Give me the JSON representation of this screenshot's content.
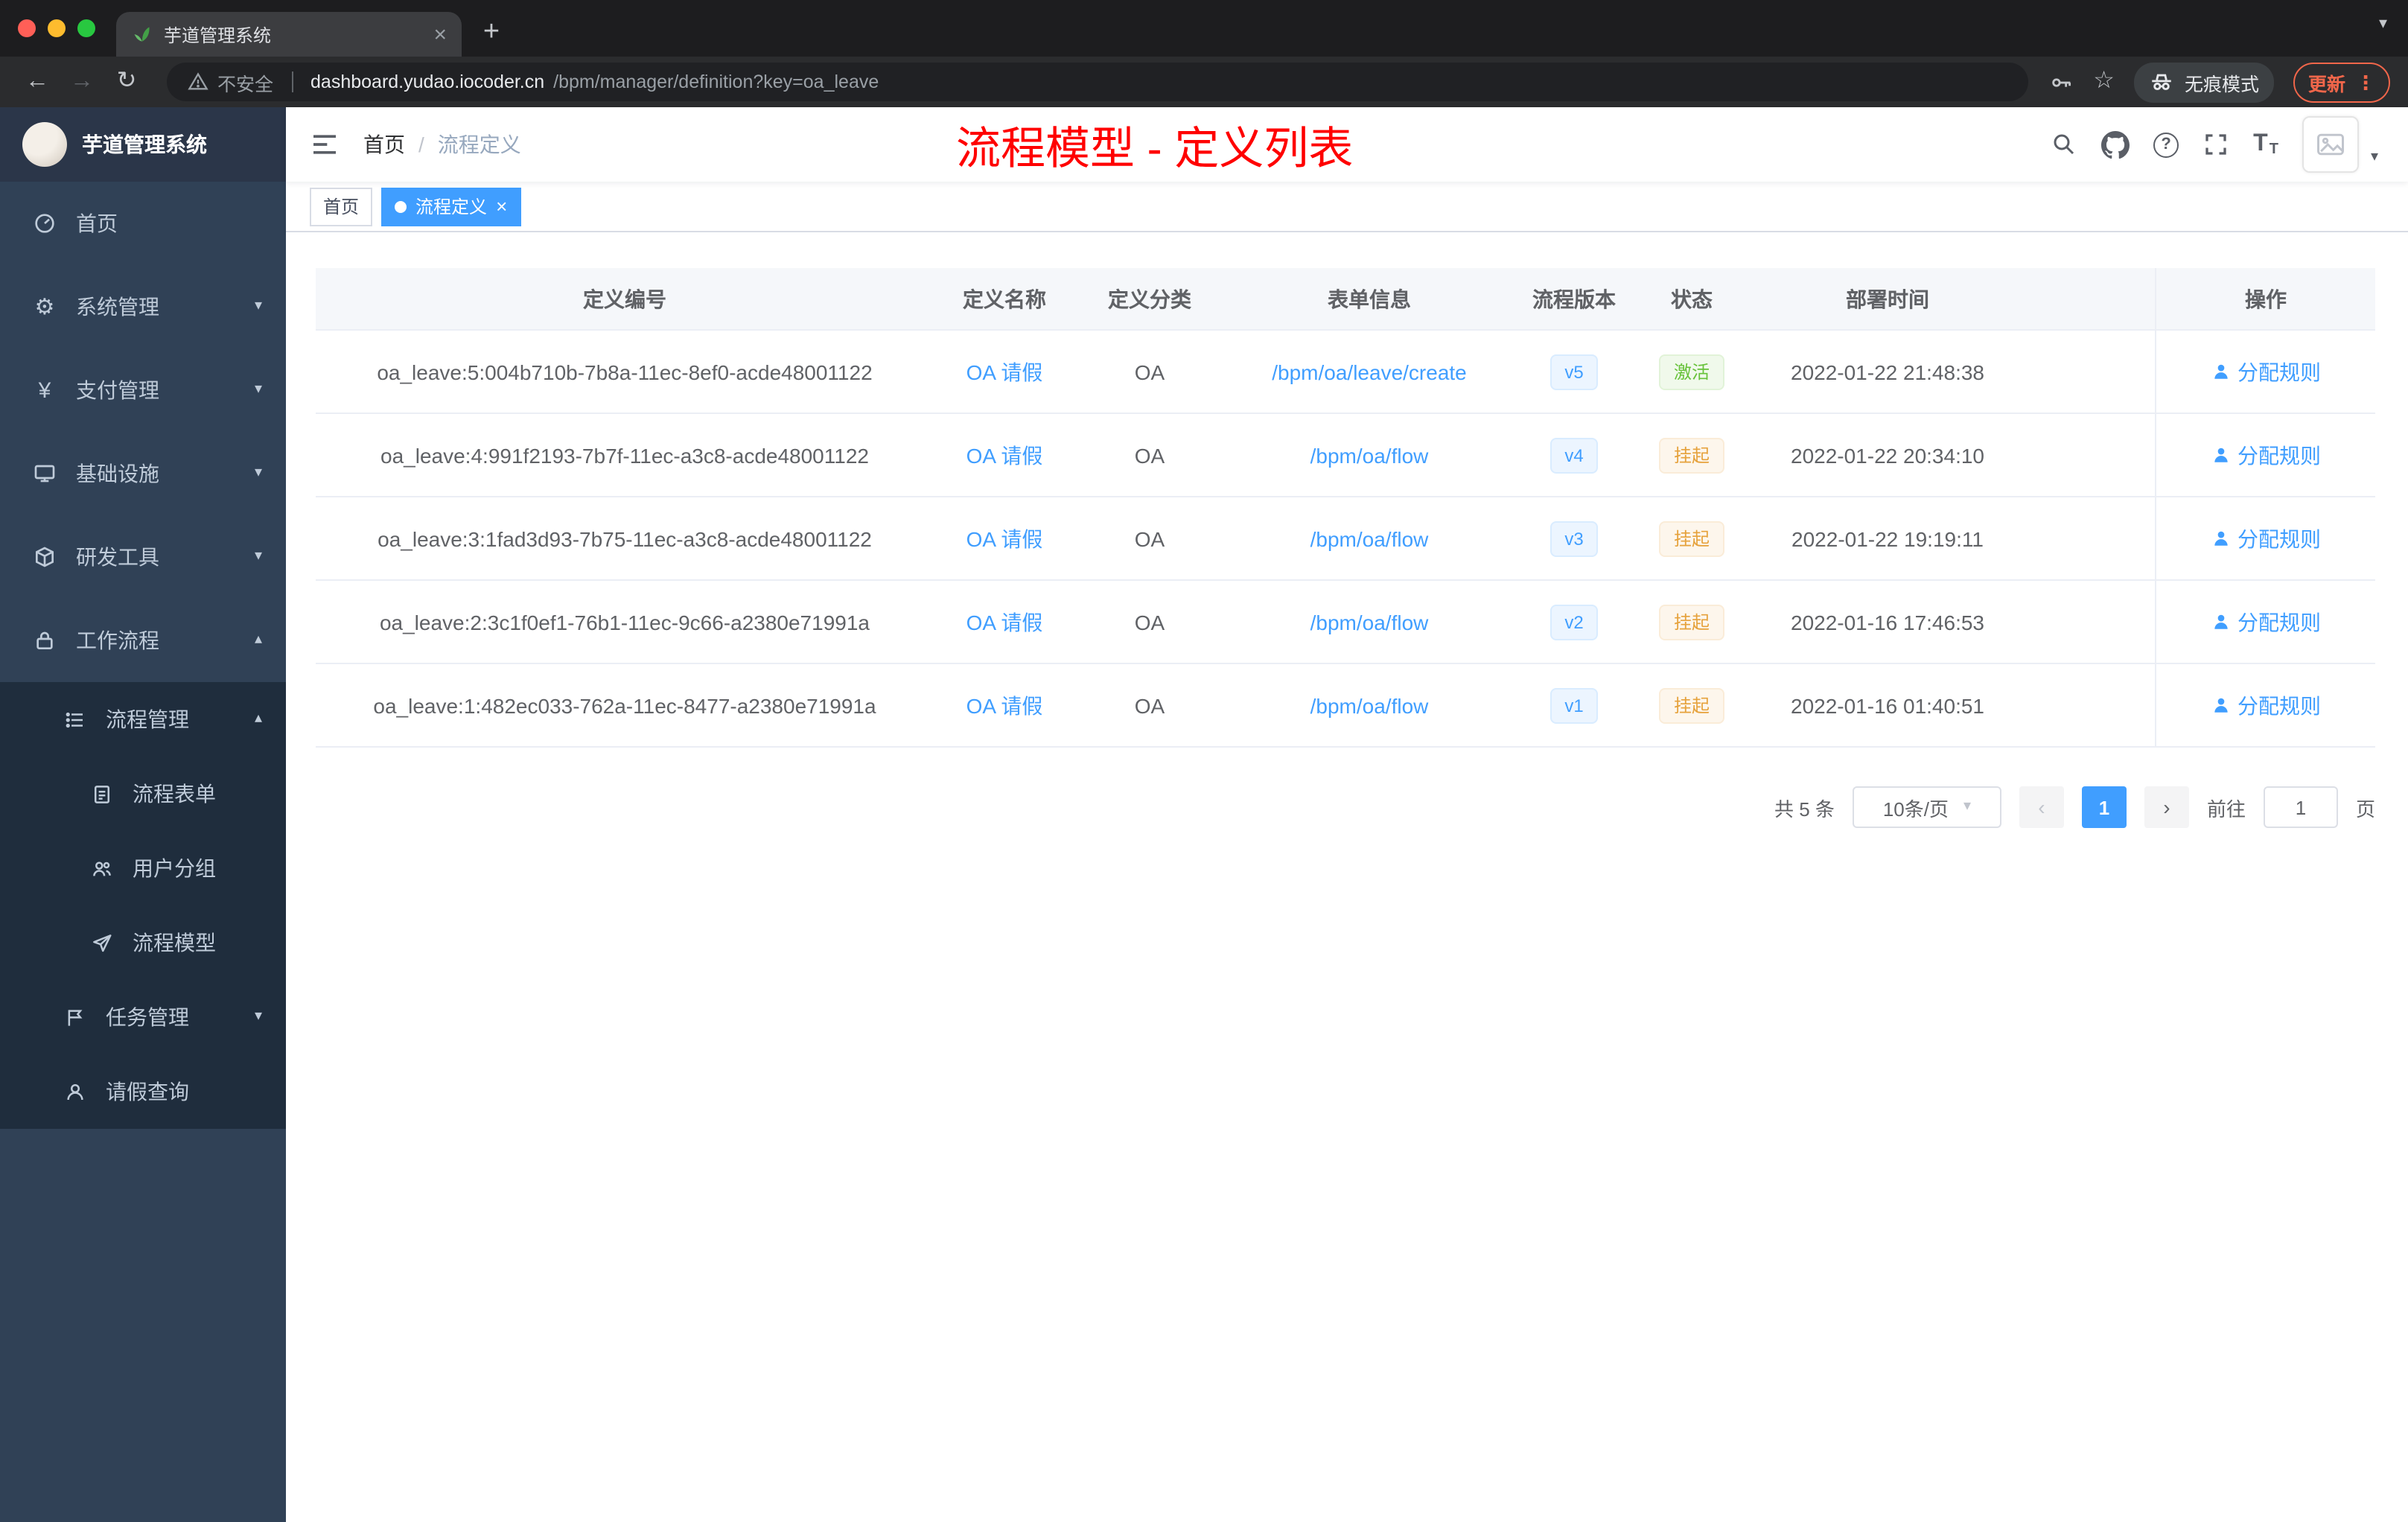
{
  "browser": {
    "tab_title": "芋道管理系统",
    "address": {
      "not_secure": "不安全",
      "domain": "dashboard.yudao.iocoder.cn",
      "path": "/bpm/manager/definition?key=oa_leave"
    },
    "incognito_label": "无痕模式",
    "update_label": "更新"
  },
  "sidebar": {
    "app_title": "芋道管理系统",
    "menu": [
      {
        "label": "首页"
      },
      {
        "label": "系统管理"
      },
      {
        "label": "支付管理"
      },
      {
        "label": "基础设施"
      },
      {
        "label": "研发工具"
      },
      {
        "label": "工作流程"
      }
    ],
    "submenu": [
      {
        "label": "流程管理"
      },
      {
        "label": "流程表单"
      },
      {
        "label": "用户分组"
      },
      {
        "label": "流程模型"
      },
      {
        "label": "任务管理"
      },
      {
        "label": "请假查询"
      }
    ]
  },
  "header": {
    "breadcrumb": [
      "首页",
      "流程定义"
    ],
    "annotation": "流程模型 - 定义列表"
  },
  "tags": [
    {
      "label": "首页"
    },
    {
      "label": "流程定义"
    }
  ],
  "table": {
    "columns": [
      "定义编号",
      "定义名称",
      "定义分类",
      "表单信息",
      "流程版本",
      "状态",
      "部署时间",
      "操作"
    ],
    "rows": [
      {
        "id": "oa_leave:5:004b710b-7b8a-11ec-8ef0-acde48001122",
        "name": "OA 请假",
        "category": "OA",
        "form": "/bpm/oa/leave/create",
        "version": "v5",
        "status": "激活",
        "deployed": "2022-01-22 21:48:38",
        "action": "分配规则"
      },
      {
        "id": "oa_leave:4:991f2193-7b7f-11ec-a3c8-acde48001122",
        "name": "OA 请假",
        "category": "OA",
        "form": "/bpm/oa/flow",
        "version": "v4",
        "status": "挂起",
        "deployed": "2022-01-22 20:34:10",
        "action": "分配规则"
      },
      {
        "id": "oa_leave:3:1fad3d93-7b75-11ec-a3c8-acde48001122",
        "name": "OA 请假",
        "category": "OA",
        "form": "/bpm/oa/flow",
        "version": "v3",
        "status": "挂起",
        "deployed": "2022-01-22 19:19:11",
        "action": "分配规则"
      },
      {
        "id": "oa_leave:2:3c1f0ef1-76b1-11ec-9c66-a2380e71991a",
        "name": "OA 请假",
        "category": "OA",
        "form": "/bpm/oa/flow",
        "version": "v2",
        "status": "挂起",
        "deployed": "2022-01-16 17:46:53",
        "action": "分配规则"
      },
      {
        "id": "oa_leave:1:482ec033-762a-11ec-8477-a2380e71991a",
        "name": "OA 请假",
        "category": "OA",
        "form": "/bpm/oa/flow",
        "version": "v1",
        "status": "挂起",
        "deployed": "2022-01-16 01:40:51",
        "action": "分配规则"
      }
    ]
  },
  "pagination": {
    "total": "共 5 条",
    "page_size": "10条/页",
    "current_page": "1",
    "goto_label": "前往",
    "goto_value": "1",
    "page_unit": "页"
  },
  "colors": {
    "primary": "#409eff",
    "success": "#67c23a",
    "warning": "#e6a23c",
    "annotation_red": "#ff0000",
    "sidebar_bg": "#304156",
    "submenu_bg": "#1f2d3d"
  }
}
